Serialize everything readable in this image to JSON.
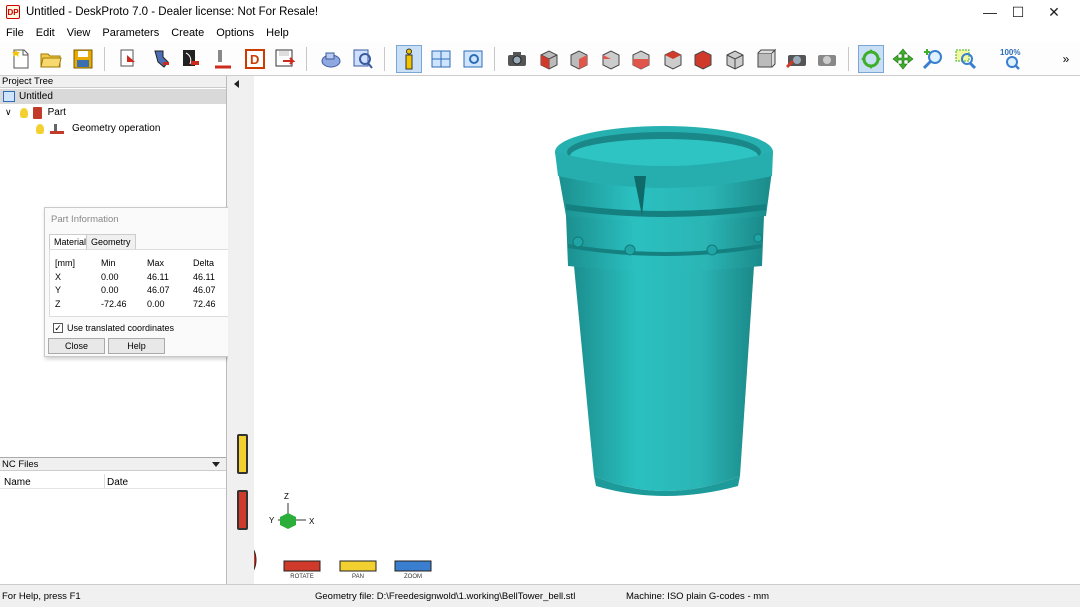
{
  "window": {
    "app_icon": "DP",
    "title": "Untitled - DeskProto 7.0 - Dealer license: Not For Resale!"
  },
  "menu": [
    "File",
    "Edit",
    "View",
    "Parameters",
    "Create",
    "Options",
    "Help"
  ],
  "toolbar_icons": [
    "new-file-icon",
    "open-folder-icon",
    "save-icon",
    "import-part-icon",
    "import-vector-icon",
    "import-bitmap-icon",
    "operation-icon",
    "design-icon",
    "export-icon",
    "parameters-icon",
    "search-icon",
    "info-icon",
    "layout-icon",
    "view-icon",
    "camera-icon",
    "view-front-icon",
    "view-back-icon",
    "view-left-icon",
    "view-right-icon",
    "view-top-icon",
    "view-bottom-icon",
    "view-iso-icon",
    "view-iso2-icon",
    "render-icon",
    "render2-icon",
    "rotate-tool-icon",
    "pan-tool-icon",
    "zoom-tool-icon",
    "zoom-window-icon",
    "zoom-100-icon",
    "overflow-icon"
  ],
  "zoom_label": "100%",
  "project_tree": {
    "header": "Project Tree",
    "root": "Untitled",
    "part": "Part",
    "operation": "Geometry operation"
  },
  "part_info": {
    "title": "Part Information",
    "tabs": [
      "Material",
      "Geometry"
    ],
    "columns": [
      "[mm]",
      "Min",
      "Max",
      "Delta"
    ],
    "rows": [
      [
        "X",
        "0.00",
        "46.11",
        "46.11"
      ],
      [
        "Y",
        "0.00",
        "46.07",
        "46.07"
      ],
      [
        "Z",
        "-72.46",
        "0.00",
        "72.46"
      ]
    ],
    "checkbox_label": "Use translated coordinates",
    "checkbox_checked": true,
    "close_label": "Close",
    "help_label": "Help"
  },
  "nc_files": {
    "header": "NC Files",
    "columns": [
      "Name",
      "Date"
    ]
  },
  "viewport": {
    "model_color": "#2bb5b5",
    "axis_labels": {
      "z": "Z",
      "y": "Y",
      "x": "X"
    },
    "controls": [
      "ROTATE",
      "PAN",
      "ZOOM"
    ]
  },
  "status": {
    "help": "For Help, press F1",
    "geometry_file": "Geometry file: D:\\Freedesignwold\\1.working\\BellTower_bell.stl",
    "machine": "Machine: ISO plain G-codes - mm"
  }
}
